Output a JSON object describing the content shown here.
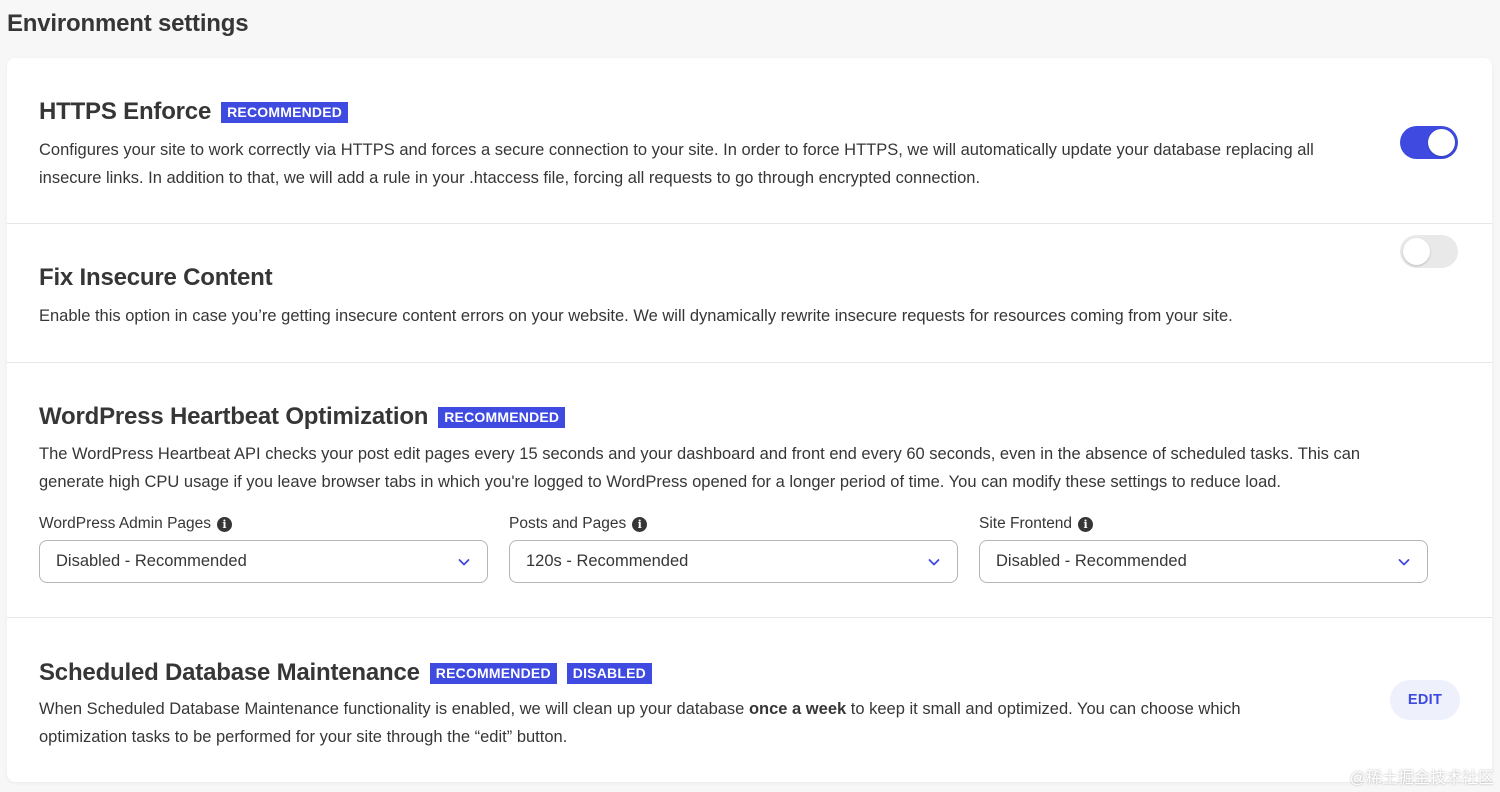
{
  "page": {
    "title": "Environment settings"
  },
  "sections": {
    "https": {
      "title": "HTTPS Enforce",
      "badges": [
        "RECOMMENDED"
      ],
      "desc_line1": "Configures your site to work correctly via HTTPS and forces a secure connection to your site. In order to force HTTPS, we will automatically update your database replacing all",
      "desc_line2": "insecure links. In addition to that, we will add a rule in your .htaccess file, forcing all requests to go through encrypted connection.",
      "enabled": true
    },
    "insecure": {
      "title": "Fix Insecure Content",
      "desc_line1": "Enable this option in case you’re getting insecure content errors on your website. We will dynamically rewrite insecure requests for resources coming from your site.",
      "enabled": false
    },
    "heartbeat": {
      "title": "WordPress Heartbeat Optimization",
      "badges": [
        "RECOMMENDED"
      ],
      "desc_line1": "The WordPress Heartbeat API checks your post edit pages every 15 seconds and your dashboard and front end every 60 seconds, even in the absence of scheduled tasks. This can",
      "desc_line2": "generate high CPU usage if you leave browser tabs in which you're logged to WordPress opened for a longer period of time. You can modify these settings to reduce load.",
      "fields": [
        {
          "label": "WordPress Admin Pages",
          "value": "Disabled - Recommended"
        },
        {
          "label": "Posts and Pages",
          "value": "120s - Recommended"
        },
        {
          "label": "Site Frontend",
          "value": "Disabled - Recommended"
        }
      ]
    },
    "maintenance": {
      "title": "Scheduled Database Maintenance",
      "badges": [
        "RECOMMENDED",
        "DISABLED"
      ],
      "desc_pre": "When Scheduled Database Maintenance functionality is enabled, we will clean up your database ",
      "desc_bold": "once a week",
      "desc_post": " to keep it small and optimized. You can choose which",
      "desc_line2": "optimization tasks to be performed for your site through the “edit” button.",
      "edit_label": "EDIT"
    }
  },
  "icons": {
    "info": "info-icon",
    "chevron": "chevron-down-icon"
  },
  "colors": {
    "accent": "#3e4ae0",
    "toggle_off": "#e9e9e9",
    "text": "#363636"
  },
  "watermark": "@稀土掘金技术社区"
}
